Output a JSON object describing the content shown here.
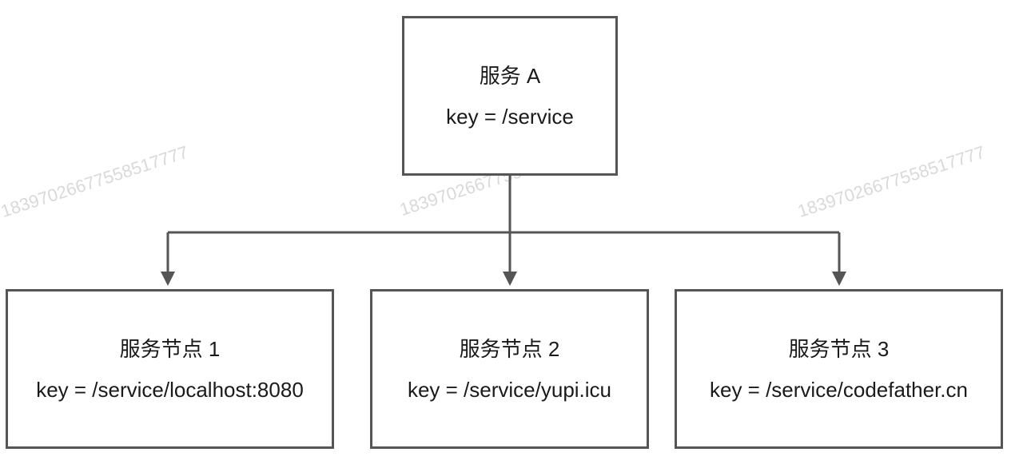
{
  "watermarks": [
    "18397026677558517777",
    "18397026677558517777",
    "18397026677558517777"
  ],
  "root": {
    "title": "服务 A",
    "key": "key = /service"
  },
  "children": [
    {
      "title": "服务节点 1",
      "key": "key = /service/localhost:8080"
    },
    {
      "title": "服务节点 2",
      "key": "key = /service/yupi.icu"
    },
    {
      "title": "服务节点 3",
      "key": "key = /service/codefather.cn"
    }
  ],
  "colors": {
    "line": "#555555",
    "border": "#555555",
    "text": "#1a1a1a",
    "watermark": "#d9d9d9"
  }
}
